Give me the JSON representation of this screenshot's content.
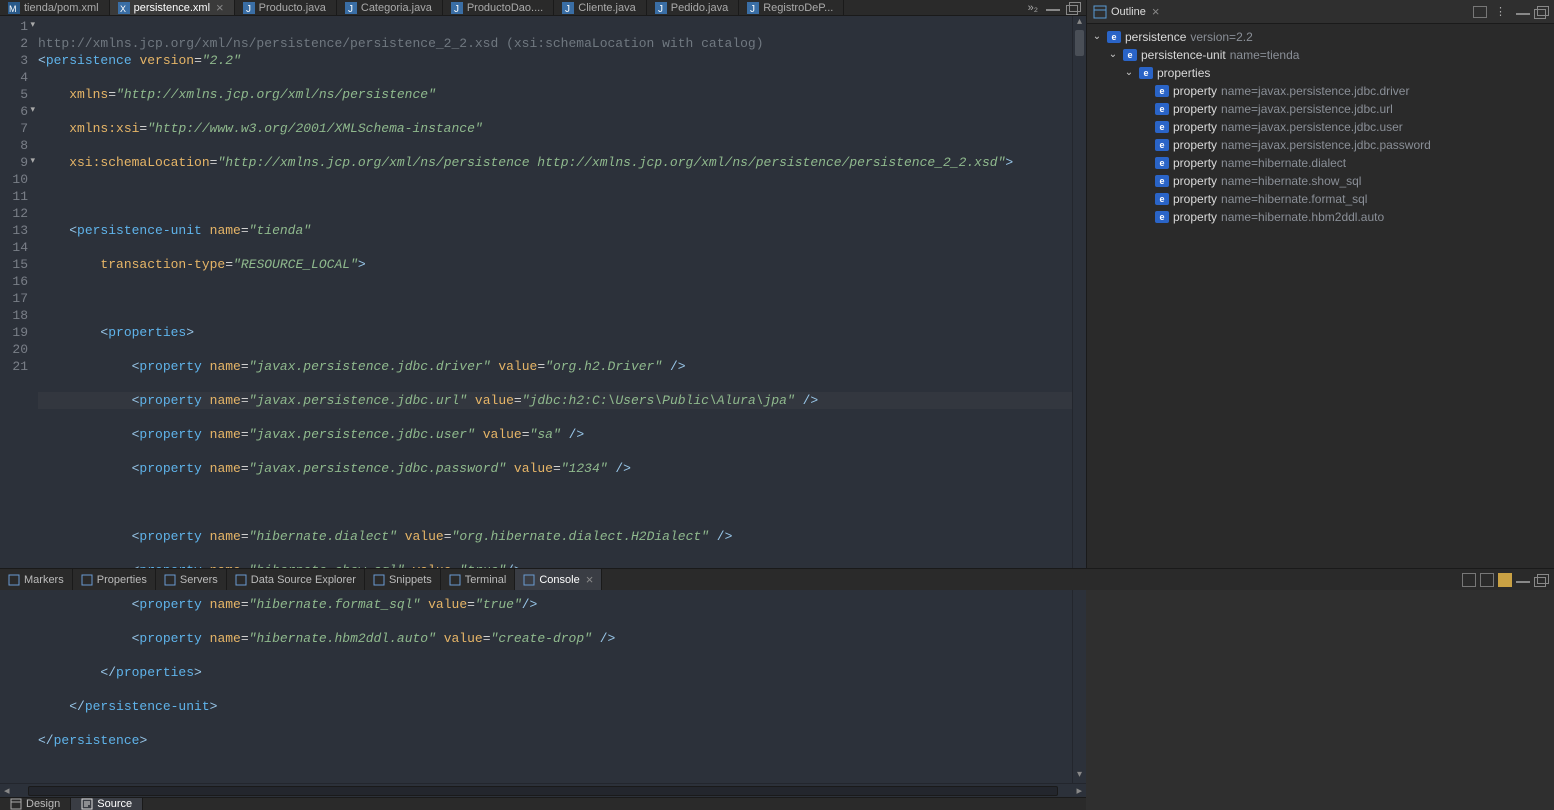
{
  "tabs": [
    {
      "label": "tienda/pom.xml",
      "icon": "M",
      "active": false
    },
    {
      "label": "persistence.xml",
      "icon": "X",
      "active": true
    },
    {
      "label": "Producto.java",
      "icon": "J",
      "active": false
    },
    {
      "label": "Categoria.java",
      "icon": "J",
      "active": false
    },
    {
      "label": "ProductoDao....",
      "icon": "J",
      "active": false
    },
    {
      "label": "Cliente.java",
      "icon": "J",
      "active": false
    },
    {
      "label": "Pedido.java",
      "icon": "J",
      "active": false
    },
    {
      "label": "RegistroDeP...",
      "icon": "J",
      "active": false
    }
  ],
  "tabs_overflow": "»₂",
  "code": {
    "header_hint": "http://xmlns.jcp.org/xml/ns/persistence/persistence_2_2.xsd (xsi:schemaLocation with catalog)",
    "lines": {
      "l1a": "<",
      "l1b": "persistence",
      "l1c": " version",
      "l1d": "=",
      "l1e": "\"2.2\"",
      "l2a": "    xmlns",
      "l2b": "=",
      "l2c": "\"http://xmlns.jcp.org/xml/ns/persistence\"",
      "l3a": "    xmlns:xsi",
      "l3b": "=",
      "l3c": "\"http://www.w3.org/2001/XMLSchema-instance\"",
      "l4a": "    xsi:schemaLocation",
      "l4b": "=",
      "l4c": "\"http://xmlns.jcp.org/xml/ns/persistence http://xmlns.jcp.org/xml/ns/persistence/persistence_2_2.xsd\"",
      "l4d": ">",
      "l6a": "    <",
      "l6b": "persistence-unit",
      "l6c": " name",
      "l6d": "=",
      "l6e": "\"tienda\"",
      "l7a": "        transaction-type",
      "l7b": "=",
      "l7c": "\"RESOURCE_LOCAL\"",
      "l7d": ">",
      "l9a": "        <",
      "l9b": "properties",
      "l9c": ">",
      "p10a": "            <",
      "p10b": "property",
      "p10c": " name",
      "p10d": "=",
      "p10e": "\"javax.persistence.jdbc.driver\"",
      "p10f": " value",
      "p10g": "=",
      "p10h": "\"org.h2.Driver\"",
      "p10i": " />",
      "p11a": "            <",
      "p11b": "property",
      "p11c": " name",
      "p11d": "=",
      "p11e": "\"javax.persistence.jdbc.url\"",
      "p11f": " value",
      "p11g": "=",
      "p11h": "\"jdbc:h2:C:\\Users\\Public\\Alura\\jpa\"",
      "p11i": " />",
      "p12a": "            <",
      "p12b": "property",
      "p12c": " name",
      "p12d": "=",
      "p12e": "\"javax.persistence.jdbc.user\"",
      "p12f": " value",
      "p12g": "=",
      "p12h": "\"sa\"",
      "p12i": " />",
      "p13a": "            <",
      "p13b": "property",
      "p13c": " name",
      "p13d": "=",
      "p13e": "\"javax.persistence.jdbc.password\"",
      "p13f": " value",
      "p13g": "=",
      "p13h": "\"1234\"",
      "p13i": " />",
      "p15a": "            <",
      "p15b": "property",
      "p15c": " name",
      "p15d": "=",
      "p15e": "\"hibernate.dialect\"",
      "p15f": " value",
      "p15g": "=",
      "p15h": "\"org.hibernate.dialect.H2Dialect\"",
      "p15i": " />",
      "p16a": "            <",
      "p16b": "property",
      "p16c": " name",
      "p16d": "=",
      "p16e": "\"hibernate.show_sql\"",
      "p16f": " value",
      "p16g": "=",
      "p16h": "\"true\"",
      "p16i": "/>",
      "p17a": "            <",
      "p17b": "property",
      "p17c": " name",
      "p17d": "=",
      "p17e": "\"hibernate.format_sql\"",
      "p17f": " value",
      "p17g": "=",
      "p17h": "\"true\"",
      "p17i": "/>",
      "p18a": "            <",
      "p18b": "property",
      "p18c": " name",
      "p18d": "=",
      "p18e": "\"hibernate.hbm2ddl.auto\"",
      "p18f": " value",
      "p18g": "=",
      "p18h": "\"create-drop\"",
      "p18i": " />",
      "l19a": "        </",
      "l19b": "properties",
      "l19c": ">",
      "l20a": "    </",
      "l20b": "persistence-unit",
      "l20c": ">",
      "l21a": "</",
      "l21b": "persistence",
      "l21c": ">"
    },
    "line_numbers": [
      "1",
      "2",
      "3",
      "4",
      "5",
      "6",
      "7",
      "8",
      "9",
      "10",
      "11",
      "12",
      "13",
      "14",
      "15",
      "16",
      "17",
      "18",
      "19",
      "20",
      "21"
    ],
    "current_line": 11
  },
  "modebar": {
    "design": "Design",
    "source": "Source"
  },
  "bottom_views": [
    {
      "label": "Markers",
      "icon": "marker"
    },
    {
      "label": "Properties",
      "icon": "prop"
    },
    {
      "label": "Servers",
      "icon": "server"
    },
    {
      "label": "Data Source Explorer",
      "icon": "dse"
    },
    {
      "label": "Snippets",
      "icon": "snip"
    },
    {
      "label": "Terminal",
      "icon": "term"
    },
    {
      "label": "Console",
      "icon": "cons",
      "active": true
    }
  ],
  "outline": {
    "title": "Outline",
    "tree": [
      {
        "d": 0,
        "tw": "v",
        "name": "persistence",
        "dim": " version=2.2"
      },
      {
        "d": 1,
        "tw": "v",
        "name": "persistence-unit",
        "dim": " name=tienda"
      },
      {
        "d": 2,
        "tw": "v",
        "name": "properties",
        "dim": ""
      },
      {
        "d": 3,
        "tw": "",
        "name": "property",
        "dim": " name=javax.persistence.jdbc.driver"
      },
      {
        "d": 3,
        "tw": "",
        "name": "property",
        "dim": " name=javax.persistence.jdbc.url"
      },
      {
        "d": 3,
        "tw": "",
        "name": "property",
        "dim": " name=javax.persistence.jdbc.user"
      },
      {
        "d": 3,
        "tw": "",
        "name": "property",
        "dim": " name=javax.persistence.jdbc.password"
      },
      {
        "d": 3,
        "tw": "",
        "name": "property",
        "dim": " name=hibernate.dialect"
      },
      {
        "d": 3,
        "tw": "",
        "name": "property",
        "dim": " name=hibernate.show_sql"
      },
      {
        "d": 3,
        "tw": "",
        "name": "property",
        "dim": " name=hibernate.format_sql"
      },
      {
        "d": 3,
        "tw": "",
        "name": "property",
        "dim": " name=hibernate.hbm2ddl.auto"
      }
    ]
  }
}
